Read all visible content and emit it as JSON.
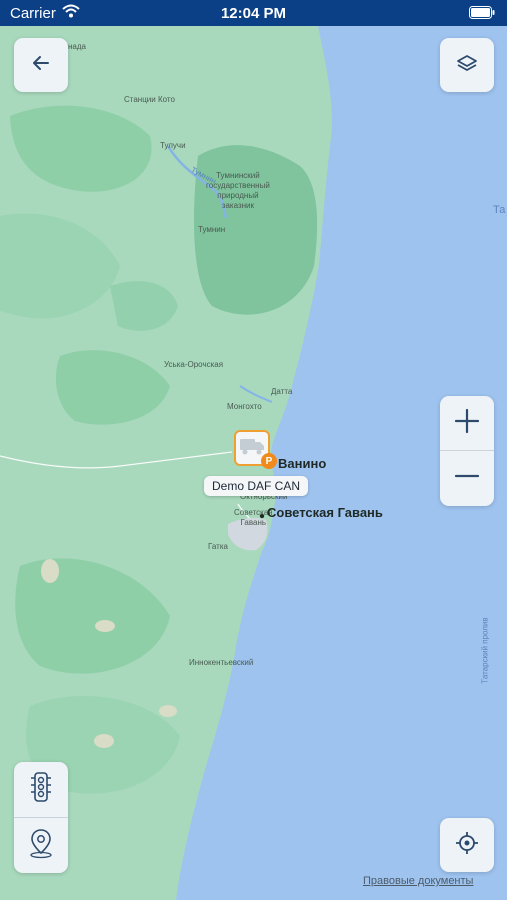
{
  "status_bar": {
    "carrier": "Carrier",
    "time": "12:04 PM"
  },
  "map": {
    "place_labels": {
      "nada": "нада",
      "stantsii_koto": "Станции Кото",
      "tuluchi": "Тулучи",
      "tumnin_river": "Тумнин",
      "reserve_line1": "Тумнинский",
      "reserve_line2": "государственный",
      "reserve_line3": "природный",
      "reserve_line4": "заказник",
      "tumnin": "Тумнин",
      "uska_orochskaya": "Уська-Орочская",
      "datta": "Датта",
      "monghokto": "Монгохто",
      "vanino_small": "Ванино",
      "oktyabrsky": "Октябрьский",
      "gatka": "Гатка",
      "sovgavan_small1": "Советская",
      "sovgavan_small2": "Гавань",
      "innokentievsky": "Иннокентьевский"
    },
    "cities": {
      "vanino": "Ванино",
      "sovetskaya_gavan": "Советская Гавань"
    },
    "water_labels": {
      "strait_fragment": "Та",
      "tatar_strait": "Татарский пролив"
    },
    "colors": {
      "water": "#9ec3ef",
      "land": "#a8d9bd",
      "forest": "#8fcfa8",
      "coast": "#7fc49c"
    }
  },
  "controls": {
    "back_icon": "arrow-left-icon",
    "layers_icon": "layers-icon",
    "zoom_in_icon": "plus-icon",
    "zoom_out_icon": "minus-icon",
    "traffic_icon": "traffic-light-icon",
    "geofence_icon": "map-pin-icon",
    "locate_icon": "crosshair-icon"
  },
  "vehicle": {
    "name": "Demo DAF CAN",
    "status_badge": "P",
    "icon": "truck-icon"
  },
  "footer": {
    "legal_link": "Правовые документы"
  }
}
